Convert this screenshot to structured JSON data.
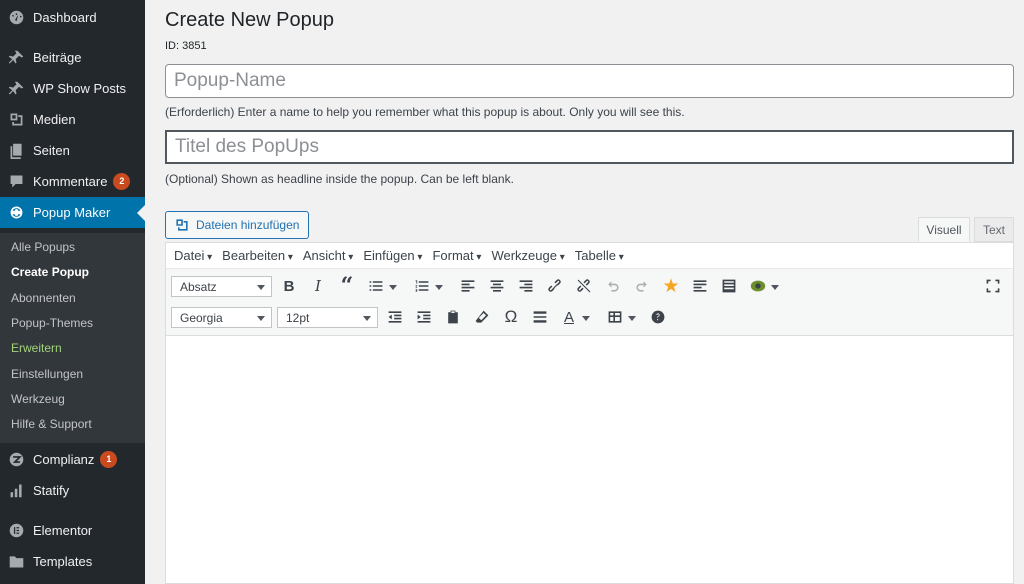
{
  "sidebar": {
    "items": [
      {
        "label": "Dashboard",
        "icon": "dashboard-icon"
      },
      {
        "label": "Beiträge",
        "icon": "pin-icon"
      },
      {
        "label": "WP Show Posts",
        "icon": "pin-icon"
      },
      {
        "label": "Medien",
        "icon": "media-icon"
      },
      {
        "label": "Seiten",
        "icon": "pages-icon"
      },
      {
        "label": "Kommentare",
        "icon": "comment-icon",
        "badge": "2"
      },
      {
        "label": "Popup Maker",
        "icon": "popup-maker-icon"
      },
      {
        "label": "Complianz",
        "icon": "complianz-icon",
        "badge": "1"
      },
      {
        "label": "Statify",
        "icon": "bar-chart-icon"
      },
      {
        "label": "Elementor",
        "icon": "elementor-icon"
      },
      {
        "label": "Templates",
        "icon": "folder-icon"
      }
    ],
    "submenu": [
      "Alle Popups",
      "Create Popup",
      "Abonnenten",
      "Popup-Themes",
      "Erweitern",
      "Einstellungen",
      "Werkzeug",
      "Hilfe & Support"
    ]
  },
  "main": {
    "title": "Create New Popup",
    "id_text": "ID: 3851",
    "name_placeholder": "Popup-Name",
    "name_help": "(Erforderlich) Enter a name to help you remember what this popup is about. Only you will see this.",
    "title_placeholder": "Titel des PopUps",
    "title_help": "(Optional) Shown as headline inside the popup. Can be left blank.",
    "media_button": "Dateien hinzufügen",
    "tabs": {
      "visual": "Visuell",
      "text": "Text"
    }
  },
  "editor": {
    "menus": [
      "Datei",
      "Bearbeiten",
      "Ansicht",
      "Einfügen",
      "Format",
      "Werkzeuge",
      "Tabelle"
    ],
    "format_select": "Absatz",
    "font_select": "Georgia",
    "size_select": "12pt"
  },
  "colors": {
    "sidebar_bg": "#23282d",
    "active": "#0073aa",
    "badge": "#ca4a1f"
  }
}
